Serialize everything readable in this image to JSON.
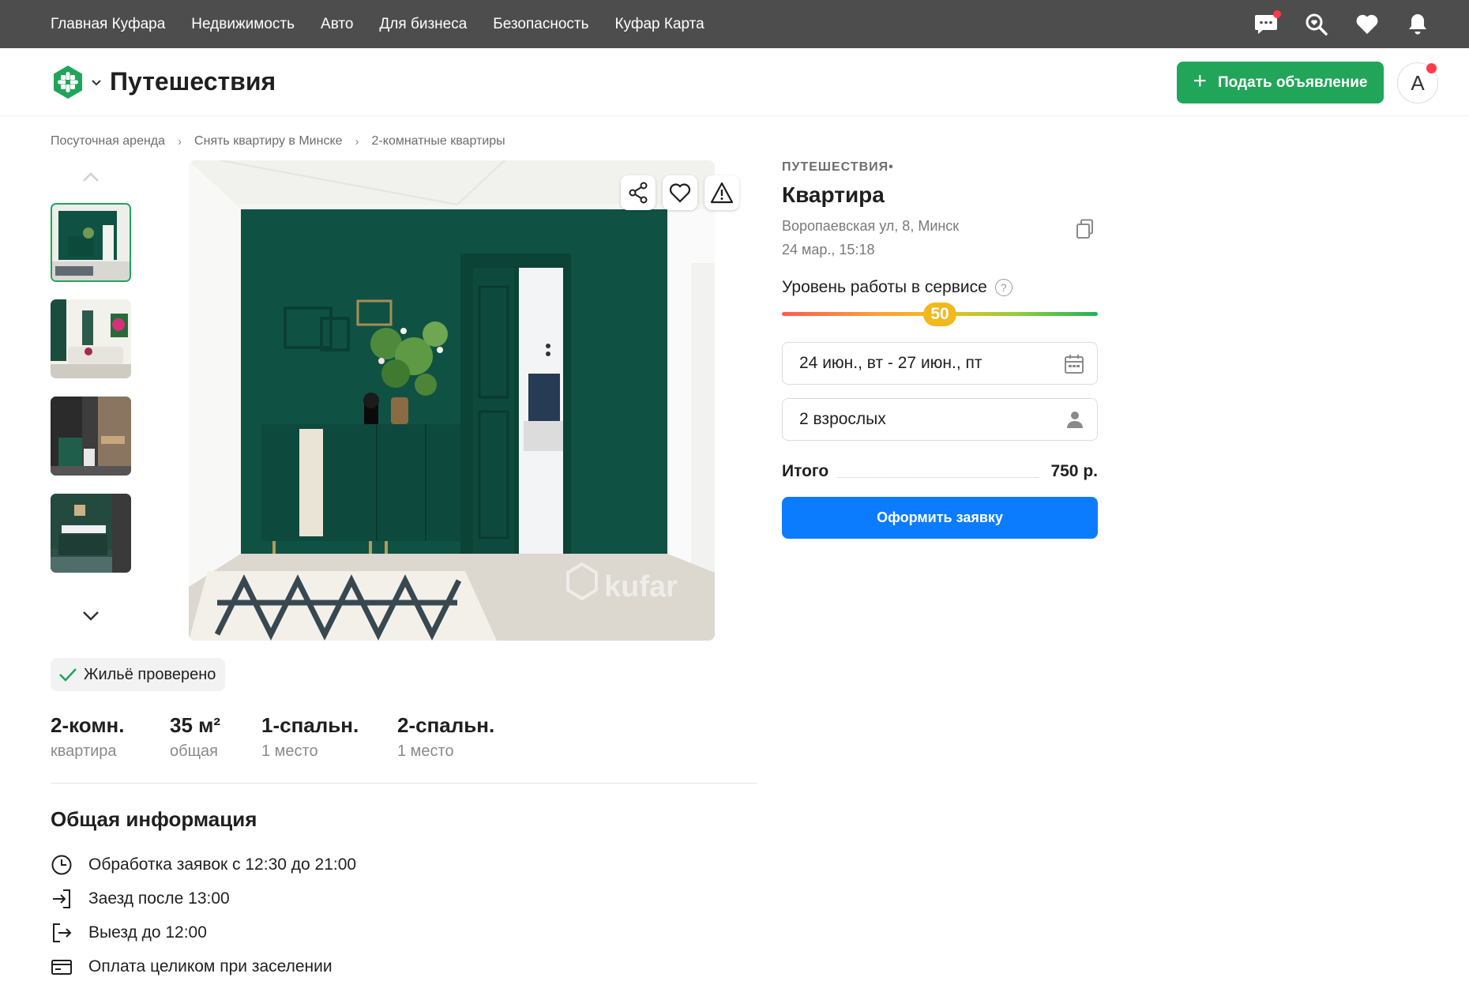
{
  "topbar": {
    "nav": [
      "Главная Куфара",
      "Недвижимость",
      "Авто",
      "Для бизнеса",
      "Безопасность",
      "Куфар Карта"
    ],
    "icons": [
      "messages-icon",
      "saved-search-icon",
      "favorites-icon",
      "notifications-icon"
    ]
  },
  "header": {
    "category_title": "Путешествия",
    "post_button": "Подать объявление",
    "avatar_letter": "А"
  },
  "breadcrumb": [
    "Посуточная аренда",
    "Снять квартиру в Минске",
    "2-комнатные квартиры"
  ],
  "listing": {
    "category": "ПУТЕШЕСТВИЯ•",
    "title": "Квартира",
    "address": "Воропаевская ул, 8, Минск",
    "date": "24 мар., 15:18",
    "service_level_label": "Уровень работы в сервисе",
    "service_level_value": "50",
    "service_level_fraction": 0.5,
    "help_glyph": "?",
    "dates_value": "24 июн., вт - 27 июн., пт",
    "guests_value": "2 взрослых",
    "total_label": "Итого",
    "total_value": "750 р.",
    "order_button": "Оформить заявку"
  },
  "photo": {
    "watermark": "kufar",
    "actions": [
      "share-icon",
      "favorite-icon",
      "report-icon"
    ]
  },
  "verified_badge": "Жильё проверено",
  "specs": [
    {
      "value": "2-комн.",
      "label": "квартира"
    },
    {
      "value": "35 м²",
      "label": "общая"
    },
    {
      "value": "1-спальн.",
      "label": "1 место"
    },
    {
      "value": "2-спальн.",
      "label": "1 место"
    }
  ],
  "general_info": {
    "title": "Общая информация",
    "items": [
      {
        "icon": "clock-icon",
        "text": "Обработка заявок с 12:30 до 21:00"
      },
      {
        "icon": "check-in-icon",
        "text": "Заезд после 13:00"
      },
      {
        "icon": "check-out-icon",
        "text": "Выезд до 12:00"
      },
      {
        "icon": "card-icon",
        "text": "Оплата целиком при заселении"
      }
    ]
  },
  "colors": {
    "topbar": "#4d4d4d",
    "brand_green": "#21a558",
    "primary_blue": "#0c7cff",
    "badge_yellow": "#f3b81c",
    "room_green": "#0f5244"
  }
}
